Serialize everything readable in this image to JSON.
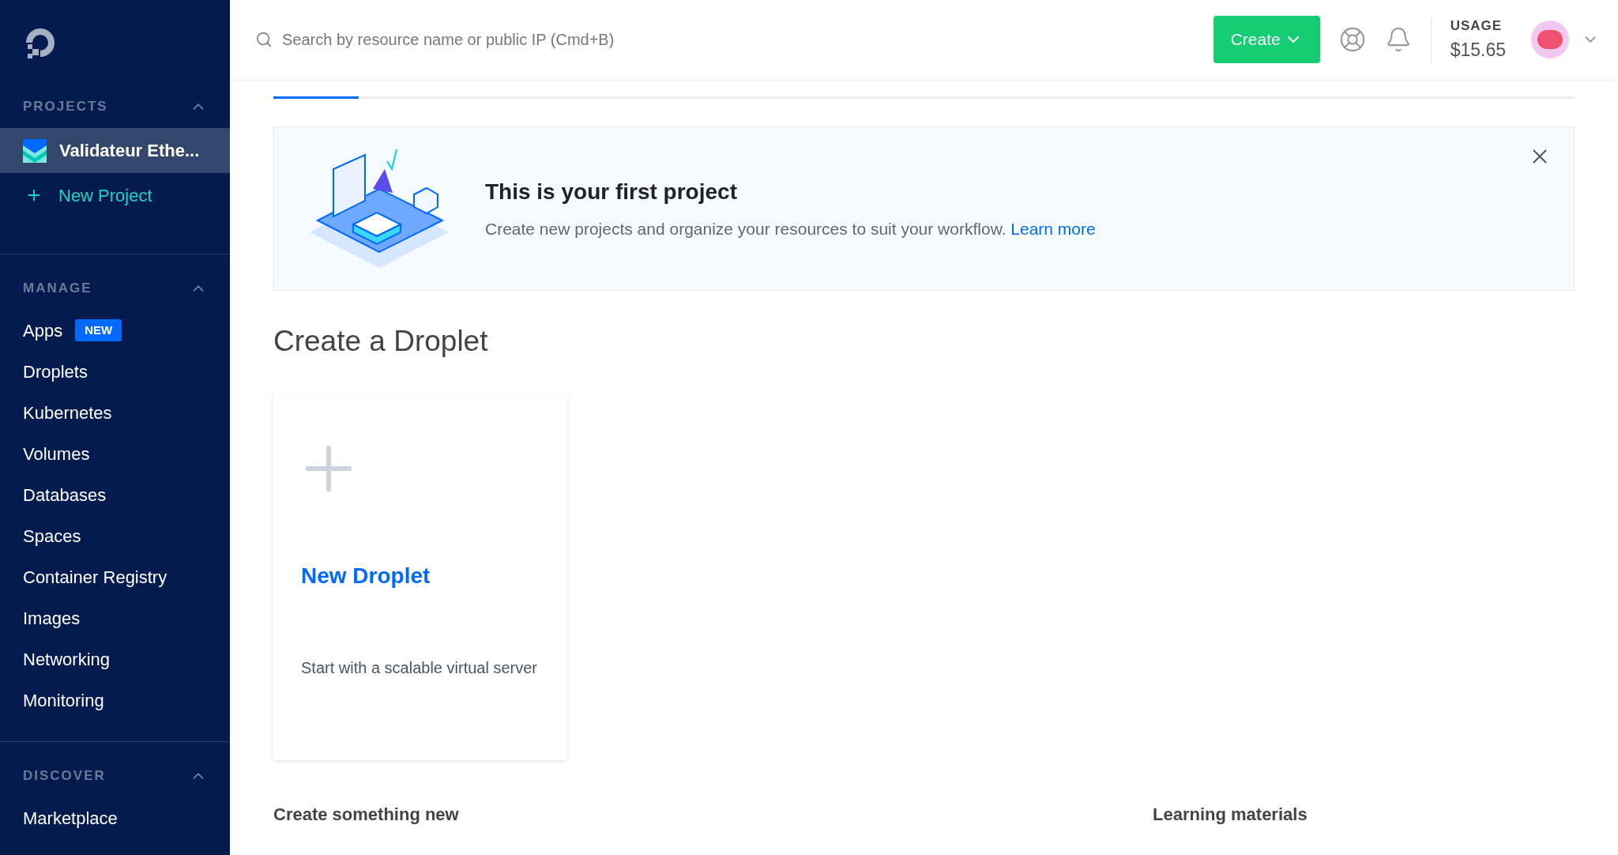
{
  "sidebar": {
    "sections": [
      {
        "title": "PROJECTS",
        "expanded": true,
        "items": [
          {
            "kind": "project",
            "label": "Validateur Ethe...",
            "selected": true
          },
          {
            "kind": "add",
            "label": "New Project",
            "selected": false
          }
        ]
      },
      {
        "title": "MANAGE",
        "expanded": true,
        "items": [
          {
            "kind": "link",
            "label": "Apps",
            "badge": "NEW",
            "selected": false
          },
          {
            "kind": "link",
            "label": "Droplets",
            "selected": false
          },
          {
            "kind": "link",
            "label": "Kubernetes",
            "selected": false
          },
          {
            "kind": "link",
            "label": "Volumes",
            "selected": false
          },
          {
            "kind": "link",
            "label": "Databases",
            "selected": false
          },
          {
            "kind": "link",
            "label": "Spaces",
            "selected": false
          },
          {
            "kind": "link",
            "label": "Container Registry",
            "selected": false
          },
          {
            "kind": "link",
            "label": "Images",
            "selected": false
          },
          {
            "kind": "link",
            "label": "Networking",
            "selected": false
          },
          {
            "kind": "link",
            "label": "Monitoring",
            "selected": false
          }
        ]
      },
      {
        "title": "DISCOVER",
        "expanded": true,
        "items": [
          {
            "kind": "link",
            "label": "Marketplace",
            "selected": false
          }
        ]
      }
    ]
  },
  "header": {
    "search": {
      "placeholder": "Search by resource name or public IP (Cmd+B)"
    },
    "create_button": "Create",
    "usage": {
      "label": "USAGE",
      "value": "$15.65"
    }
  },
  "banner": {
    "title": "This is your first project",
    "text": "Create new projects and organize your resources to suit your workflow.",
    "link": "Learn more"
  },
  "droplet_section": {
    "heading": "Create a Droplet",
    "card": {
      "title": "New Droplet",
      "description": "Start with a scalable virtual server"
    }
  },
  "bottom_headings": [
    "Create something new",
    "Learning materials"
  ]
}
